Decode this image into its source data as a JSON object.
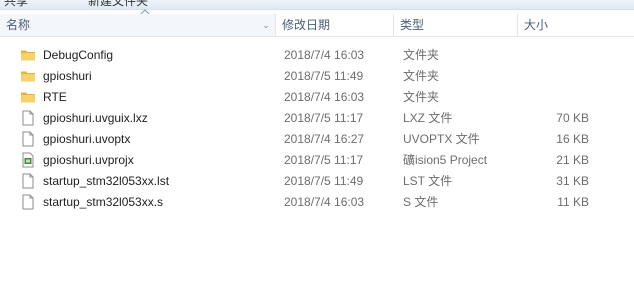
{
  "toolbar": {
    "fragment_left": "共享",
    "fragment_mid": "新建文件夹"
  },
  "columns": {
    "name": "名称",
    "date": "修改日期",
    "type": "类型",
    "size": "大小"
  },
  "files": [
    {
      "name": "DebugConfig",
      "date": "2018/7/4 16:03",
      "type": "文件夹",
      "size": "",
      "icon": "folder-icon"
    },
    {
      "name": "gpioshuri",
      "date": "2018/7/5 11:49",
      "type": "文件夹",
      "size": "",
      "icon": "folder-icon"
    },
    {
      "name": "RTE",
      "date": "2018/7/4 16:03",
      "type": "文件夹",
      "size": "",
      "icon": "folder-icon"
    },
    {
      "name": "gpioshuri.uvguix.lxz",
      "date": "2018/7/5 11:17",
      "type": "LXZ 文件",
      "size": "70 KB",
      "icon": "file-icon"
    },
    {
      "name": "gpioshuri.uvoptx",
      "date": "2018/7/4 16:27",
      "type": "UVOPTX 文件",
      "size": "16 KB",
      "icon": "file-icon"
    },
    {
      "name": "gpioshuri.uvprojx",
      "date": "2018/7/5 11:17",
      "type": "礦ision5 Project",
      "size": "21 KB",
      "icon": "uvision-project-icon"
    },
    {
      "name": "startup_stm32l053xx.lst",
      "date": "2018/7/5 11:49",
      "type": "LST 文件",
      "size": "31 KB",
      "icon": "file-icon"
    },
    {
      "name": "startup_stm32l053xx.s",
      "date": "2018/7/4 16:03",
      "type": "S 文件",
      "size": "11 KB",
      "icon": "file-icon"
    }
  ]
}
